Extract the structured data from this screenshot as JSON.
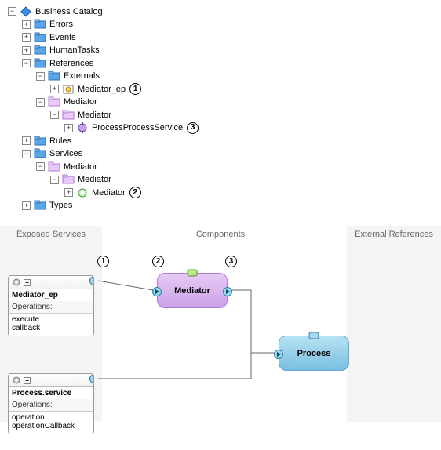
{
  "tree": {
    "root": {
      "label": "Business Catalog",
      "toggle": "−"
    },
    "errors": {
      "label": "Errors",
      "toggle": "+"
    },
    "events": {
      "label": "Events",
      "toggle": "+"
    },
    "humantasks": {
      "label": "HumanTasks",
      "toggle": "+"
    },
    "references": {
      "label": "References",
      "toggle": "−"
    },
    "externals": {
      "label": "Externals",
      "toggle": "−"
    },
    "mediator_ep": {
      "label": "Mediator_ep",
      "toggle": "+",
      "callout": "1"
    },
    "ref_mediator": {
      "label": "Mediator",
      "toggle": "−"
    },
    "ref_mediator_inner": {
      "label": "Mediator",
      "toggle": "−"
    },
    "process_svc": {
      "label": "ProcessProcessService",
      "toggle": "+",
      "callout": "3"
    },
    "rules": {
      "label": "Rules",
      "toggle": "+"
    },
    "services": {
      "label": "Services",
      "toggle": "−"
    },
    "svc_mediator": {
      "label": "Mediator",
      "toggle": "−"
    },
    "svc_mediator_inner": {
      "label": "Mediator",
      "toggle": "−"
    },
    "svc_mediator_leaf": {
      "label": "Mediator",
      "toggle": "+",
      "callout": "2"
    },
    "types": {
      "label": "Types",
      "toggle": "+"
    }
  },
  "diagram": {
    "lanes": {
      "exposed": "Exposed Services",
      "components": "Components",
      "external": "External References"
    },
    "components": {
      "mediator": "Mediator",
      "process": "Process"
    },
    "service1": {
      "name": "Mediator_ep",
      "section": "Operations:",
      "ops": [
        "execute",
        "callback"
      ]
    },
    "service2": {
      "name": "Process.service",
      "section": "Operations:",
      "ops": [
        "operation",
        "operationCallback"
      ]
    },
    "callouts": {
      "c1": "1",
      "c2": "2",
      "c3": "3"
    }
  }
}
